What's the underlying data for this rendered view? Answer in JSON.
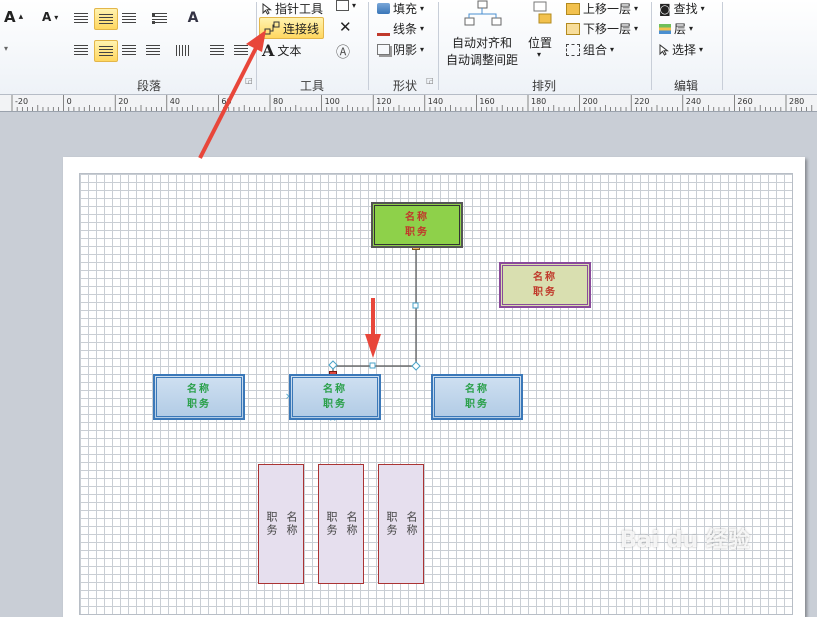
{
  "font": {
    "grow": "A",
    "shrink": "A"
  },
  "tools": {
    "pointer_label": "指针工具",
    "connector_label": "连接线",
    "text_label": "文本"
  },
  "shape_group": {
    "fill_label": "填充",
    "line_label": "线条",
    "shadow_label": "阴影"
  },
  "arrange": {
    "auto_align_line1": "自动对齐和",
    "auto_align_line2": "自动调整间距",
    "position_label": "位置",
    "bring_forward_label": "上移一层",
    "send_backward_label": "下移一层",
    "group_label": "组合"
  },
  "edit": {
    "find_label": "查找",
    "layer_label": "层",
    "select_label": "选择"
  },
  "group_labels": {
    "paragraph": "段落",
    "tools": "工具",
    "shape": "形状",
    "arrange": "排列",
    "edit": "编辑"
  },
  "ruler": {
    "ticks": [
      "-20",
      "0",
      "20",
      "40",
      "60",
      "80",
      "100",
      "120",
      "140",
      "160",
      "180",
      "200",
      "220",
      "240",
      "260",
      "280"
    ]
  },
  "shapes": {
    "top": {
      "name": "名称",
      "title": "职务",
      "fill": "#8ed14a",
      "text_color": "#c0392b"
    },
    "right": {
      "name": "名称",
      "title": "职务",
      "fill": "#d9dfb0",
      "text_color": "#c0392b"
    },
    "blue_left": {
      "name": "名称",
      "title": "职务",
      "fill": "#bfd5ea",
      "text_color": "#2aa04a"
    },
    "blue_mid": {
      "name": "名称",
      "title": "职务",
      "fill": "#bfd5ea",
      "text_color": "#2aa04a"
    },
    "blue_right": {
      "name": "名称",
      "title": "职务",
      "fill": "#bfd5ea",
      "text_color": "#2aa04a"
    },
    "vertical": [
      {
        "col1": "名称",
        "col2": "职务"
      },
      {
        "col1": "名称",
        "col2": "职务"
      },
      {
        "col1": "名称",
        "col2": "职务"
      }
    ]
  },
  "colors": {
    "arrow": "#e8463a",
    "connector_handle": "#4aa3c8"
  },
  "watermark": "Bai du 经验"
}
